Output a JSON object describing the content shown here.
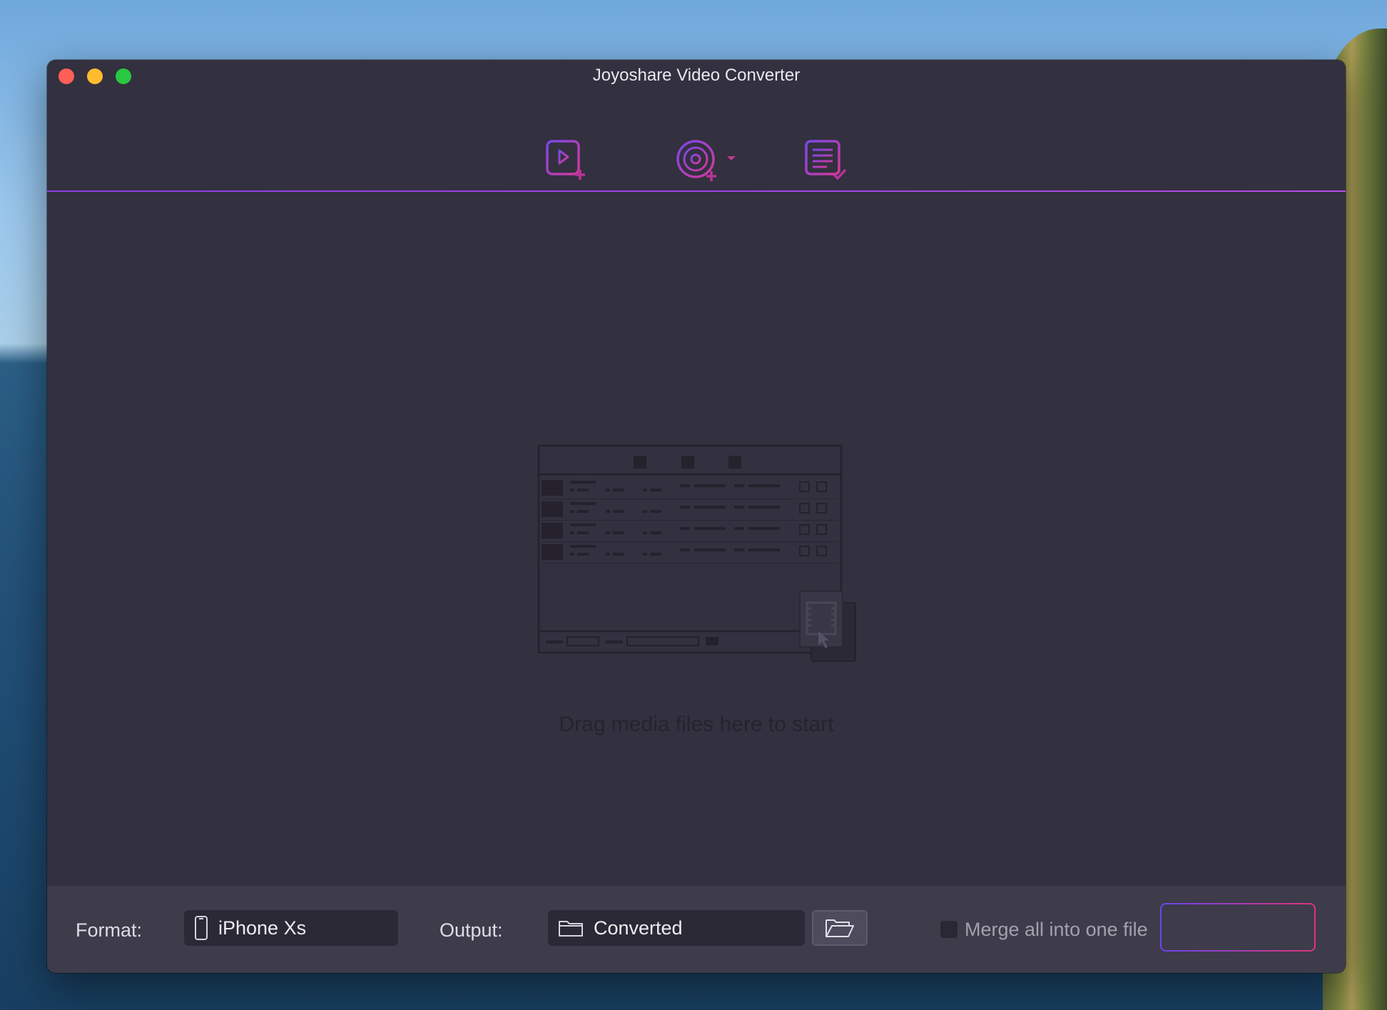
{
  "window": {
    "title": "Joyoshare Video Converter"
  },
  "toolbar": {
    "icons": [
      "add-video-icon",
      "add-dvd-icon",
      "task-list-icon"
    ]
  },
  "dropzone": {
    "text": "Drag media files here to start"
  },
  "bottom": {
    "format_label": "Format:",
    "format_value": "iPhone Xs",
    "output_label": "Output:",
    "output_value": "Converted",
    "merge_label": "Merge all into one file",
    "merge_checked": false,
    "convert_label": ""
  },
  "colors": {
    "window_bg": "#33303f",
    "bottom_bar_bg": "#3e3b4b",
    "accent_purple": "#9b45e6",
    "accent_pink": "#e0337a"
  }
}
